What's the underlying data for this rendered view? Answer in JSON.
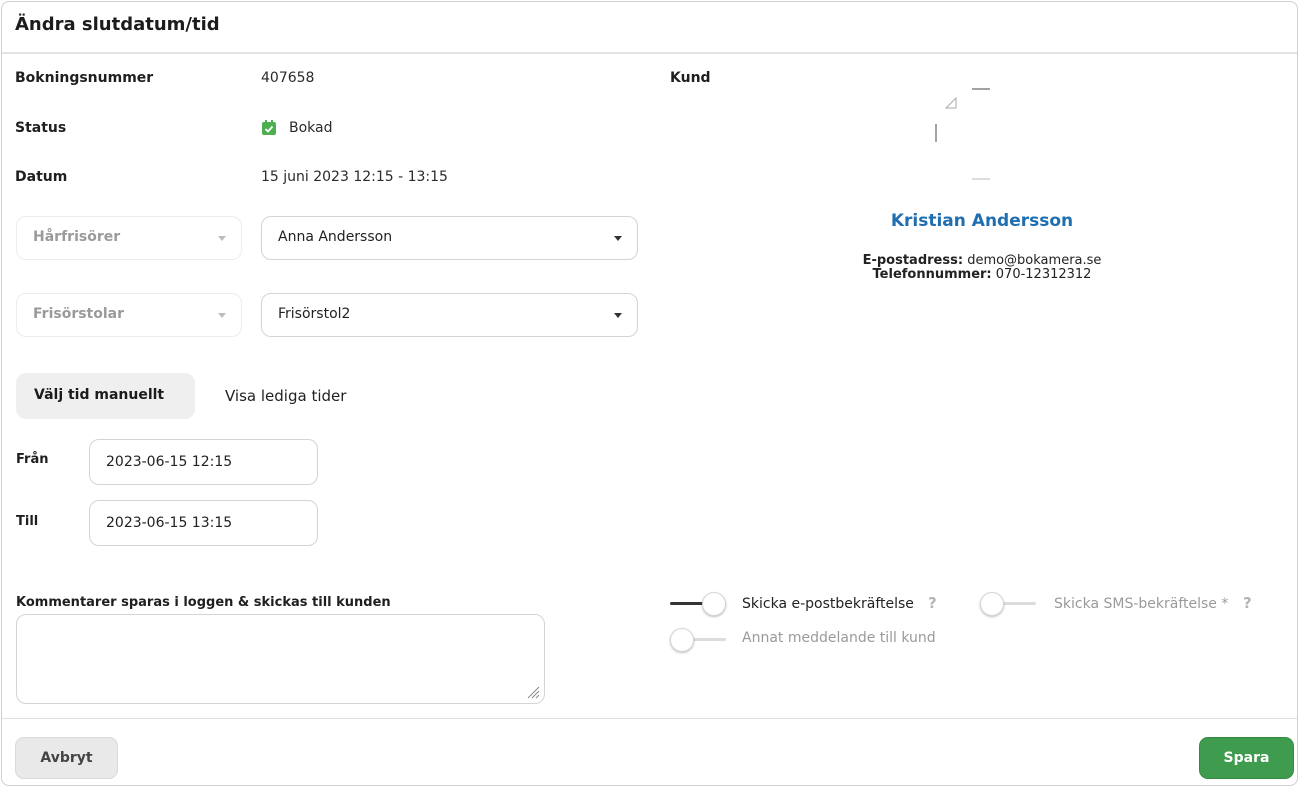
{
  "dialog": {
    "title": "Ändra slutdatum/tid"
  },
  "booking": {
    "number_label": "Bokningsnummer",
    "number_value": "407658",
    "status_label": "Status",
    "status_value": "Bokad",
    "date_label": "Datum",
    "date_value": "15 juni 2023 12:15 - 13:15"
  },
  "resources": [
    {
      "type": "Hårfrisörer",
      "selected": "Anna Andersson"
    },
    {
      "type": "Frisörstolar",
      "selected": "Frisörstol2"
    }
  ],
  "time_tabs": {
    "manual": "Välj tid manuellt",
    "available": "Visa lediga tider"
  },
  "time": {
    "from_label": "Från",
    "from_value": "2023-06-15 12:15",
    "to_label": "Till",
    "to_value": "2023-06-15 13:15"
  },
  "comment": {
    "label": "Kommentarer sparas i loggen & skickas till kunden",
    "value": ""
  },
  "customer": {
    "label": "Kund",
    "name": "Kristian Andersson",
    "email_label": "E-postadress:",
    "email": "demo@bokamera.se",
    "phone_label": "Telefonnummer:",
    "phone": "070-12312312"
  },
  "notifications": [
    {
      "label": "Skicka e-postbekräftelse",
      "on": true,
      "help": "?"
    },
    {
      "label": "Skicka SMS-bekräftelse *",
      "on": false,
      "help": "?"
    },
    {
      "label": "Annat meddelande till kund",
      "on": false
    }
  ],
  "footer": {
    "cancel": "Avbryt",
    "save": "Spara"
  },
  "colors": {
    "accent_blue": "#1f6fb0",
    "save_green": "#3f9c4e",
    "status_green": "#4caf50"
  }
}
